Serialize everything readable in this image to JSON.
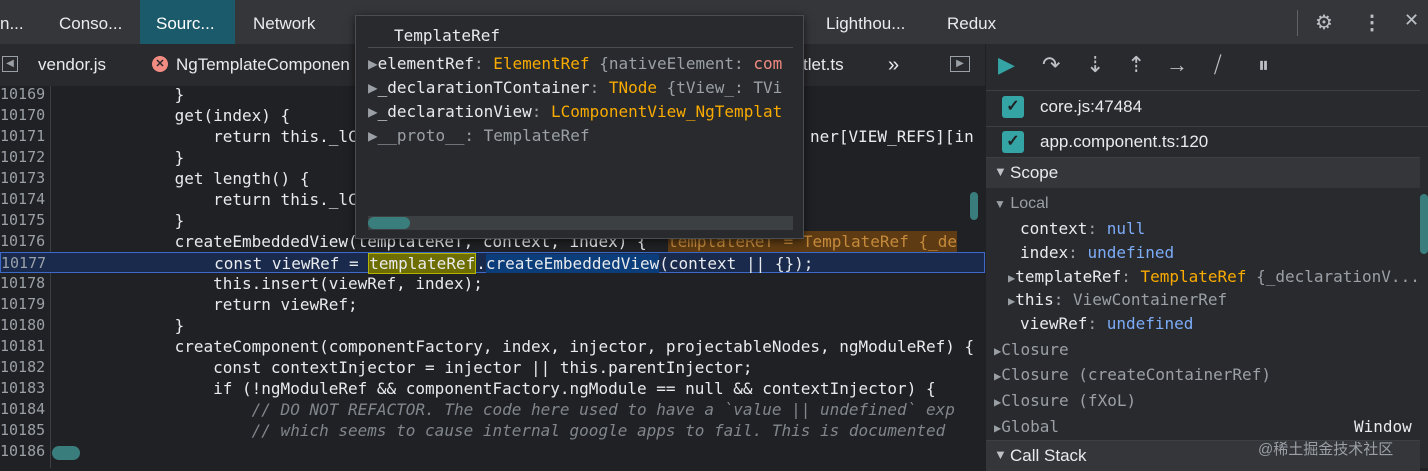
{
  "topbar": {
    "tabs": [
      {
        "label": "n..."
      },
      {
        "label": "Conso..."
      },
      {
        "label": "Sourc..."
      },
      {
        "label": "Network"
      },
      {
        "label": "Lighthou..."
      },
      {
        "label": "Redux"
      }
    ]
  },
  "filebar": {
    "tab1": "vendor.js",
    "tab2": "NgTemplateComponen",
    "tab3": "tlet.ts",
    "more": "»"
  },
  "code": {
    "lines": [
      {
        "n": "10169",
        "t": "            }"
      },
      {
        "n": "10170",
        "t": "            get(index) {"
      },
      {
        "n": "10171",
        "t": "                return this._lC"
      },
      {
        "n": "10172",
        "t": "            }"
      },
      {
        "n": "10173",
        "t": "            get length() {"
      },
      {
        "n": "10174",
        "t": "                return this._lC"
      },
      {
        "n": "10175",
        "t": "            }"
      },
      {
        "n": "10176",
        "t": "            createEmbeddedView(templateRef, context, index) {"
      },
      {
        "n": "10177",
        "t": ""
      },
      {
        "n": "10178",
        "t": "                this.insert(viewRef, index);"
      },
      {
        "n": "10179",
        "t": "                return viewRef;"
      },
      {
        "n": "10180",
        "t": "            }"
      },
      {
        "n": "10181",
        "t": "            createComponent(componentFactory, index, injector, projectableNodes, ngModuleRef) {"
      },
      {
        "n": "10182",
        "t": "                const contextInjector = injector || this.parentInjector;"
      },
      {
        "n": "10183",
        "t": "                if (!ngModuleRef && componentFactory.ngModule == null && contextInjector) {"
      },
      {
        "n": "10184",
        "t": "                    // DO NOT REFACTOR. The code here used to have a `value || undefined` exp"
      },
      {
        "n": "10185",
        "t": "                    // which seems to cause internal google apps to fail. This is documented"
      },
      {
        "n": "10186",
        "t": ""
      }
    ],
    "line10171_tail": "ner[VIEW_REFS][in",
    "inline_hint": "templateRef = TemplateRef {_de",
    "line10177": {
      "prefix": "                const viewRef = ",
      "hl_word": "templateRef",
      "dot": ".",
      "method": "createEmbeddedView",
      "suffix": "(context || {});"
    }
  },
  "popover": {
    "title": "TemplateRef",
    "rows": [
      {
        "key": "elementRef",
        "type": "ElementRef",
        "rest": " {nativeElement: ",
        "extra": "com"
      },
      {
        "key": "_declarationTContainer",
        "type": "TNode",
        "rest": " {tView_: ",
        "extra": "TVi"
      },
      {
        "key": "_declarationView",
        "type": "LComponentView_NgTemplat",
        "rest": "",
        "extra": ""
      },
      {
        "key": "__proto__",
        "type": "TemplateRef",
        "rest": "",
        "extra": ""
      }
    ]
  },
  "sidebar": {
    "breakpoints": [
      {
        "label": "core.js:47484",
        "checked": true
      },
      {
        "label": "app.component.ts:120",
        "checked": true
      }
    ],
    "scope_label": "Scope",
    "local_label": "Local",
    "local_vars": [
      {
        "key": "context",
        "value": "null"
      },
      {
        "key": "index",
        "value": "undefined"
      },
      {
        "key": "templateRef",
        "value": "TemplateRef",
        "rest": " {_declarationV..."
      },
      {
        "key": "this",
        "value": "ViewContainerRef"
      },
      {
        "key": "viewRef",
        "value": "undefined"
      }
    ],
    "closures": [
      "Closure",
      "Closure (createContainerRef)",
      "Closure (fXoL)"
    ],
    "global_label": "Global",
    "global_value": "Window",
    "callstack_label": "Call Stack"
  },
  "watermark": "@稀土掘金技术社区"
}
